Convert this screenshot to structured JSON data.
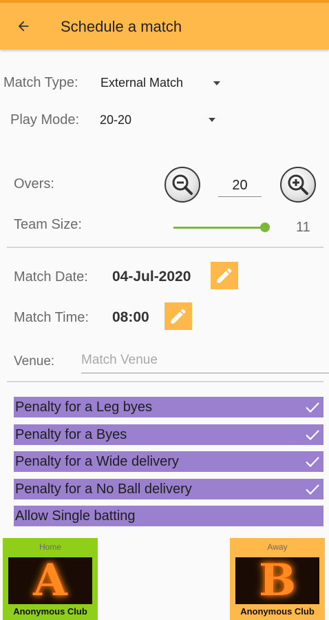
{
  "appbar": {
    "title": "Schedule a match",
    "back_icon": "arrow-back-icon"
  },
  "form": {
    "match_type": {
      "label": "Match Type:",
      "value": "External Match"
    },
    "play_mode": {
      "label": "Play Mode:",
      "value": "20-20"
    },
    "overs": {
      "label": "Overs:",
      "value": "20"
    },
    "team_size": {
      "label": "Team Size:",
      "value": "11",
      "slider_fraction": 1.0
    },
    "match_date": {
      "label": "Match Date:",
      "value": "04-Jul-2020"
    },
    "match_time": {
      "label": "Match Time:",
      "value": "08:00"
    },
    "venue": {
      "label": "Venue:",
      "placeholder": "Match Venue"
    }
  },
  "penalties": [
    {
      "label": "Penalty for a Leg byes",
      "checked": true
    },
    {
      "label": "Penalty for a Byes",
      "checked": true
    },
    {
      "label": "Penalty for a Wide delivery",
      "checked": true
    },
    {
      "label": "Penalty for a No Ball delivery",
      "checked": true
    },
    {
      "label": "Allow Single batting",
      "checked": false
    }
  ],
  "teams": {
    "home": {
      "side": "Home",
      "letter": "A",
      "name": "Anonymous Club",
      "color": "#8fcf1a"
    },
    "away": {
      "side": "Away",
      "letter": "B",
      "name": "Anonymous Club",
      "color": "#ffb84a"
    }
  },
  "colors": {
    "appbar": "#ffb84a",
    "accent_green": "#7ab83a",
    "penalty_bg": "#9a80cf"
  }
}
